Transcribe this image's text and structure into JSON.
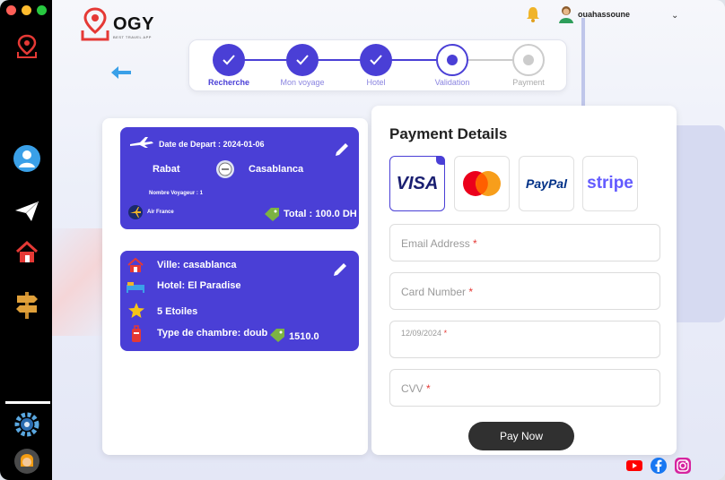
{
  "app": {
    "logo_text": "OGY",
    "logo_sub": "BEST TRAVEL APP",
    "user_name": "ouahassoune"
  },
  "stepper": [
    {
      "label": "Recherche",
      "state": "done"
    },
    {
      "label": "Mon voyage",
      "state": "done"
    },
    {
      "label": "Hotel",
      "state": "done"
    },
    {
      "label": "Validation",
      "state": "current"
    },
    {
      "label": "Payment",
      "state": "todo"
    }
  ],
  "flight": {
    "date_label": "Date de Depart : 2024-01-06",
    "from": "Rabat",
    "to": "Casablanca",
    "travelers": "Nombre Voyageur : 1",
    "airline": "Air France",
    "total": "Total : 100.0 DH"
  },
  "hotel": {
    "ville": "Ville: casablanca",
    "hotel": "Hotel: El Paradise",
    "stars": "5 Etoiles",
    "room_type": "Type de chambre: doub",
    "price": "1510.0"
  },
  "payment": {
    "title": "Payment Details",
    "methods": [
      {
        "name": "visa",
        "label": "VISA",
        "selected": true
      },
      {
        "name": "mastercard",
        "label": "",
        "selected": false
      },
      {
        "name": "paypal",
        "label": "PayPal",
        "selected": false
      },
      {
        "name": "stripe",
        "label": "stripe",
        "selected": false
      }
    ],
    "email_placeholder": "Email Address",
    "card_placeholder": "Card Number",
    "date_value": "12/09/2024",
    "cvv_placeholder": "CVV",
    "required_mark": "*",
    "pay_label": "Pay Now"
  },
  "colors": {
    "accent": "#4a3fd6",
    "sidebar": "#000000",
    "pay_button": "#303030"
  }
}
